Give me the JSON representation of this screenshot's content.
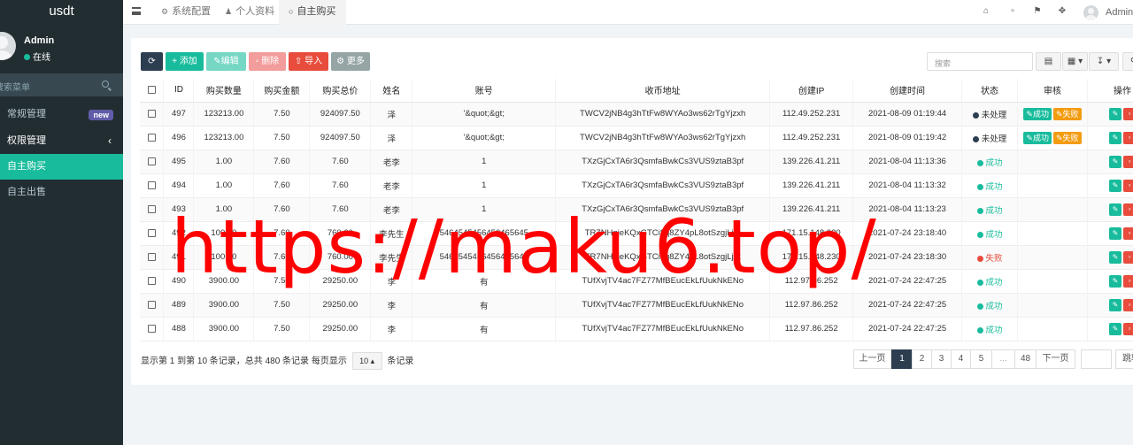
{
  "app": {
    "title": "usdt"
  },
  "sidebar": {
    "user": {
      "name": "Admin",
      "status": "在线"
    },
    "search_placeholder": "搜索菜单",
    "items": [
      {
        "label": "常规管理",
        "badge": "new"
      },
      {
        "label": "权限管理",
        "chevron": "‹"
      },
      {
        "label": "自主购买"
      },
      {
        "label": "自主出售"
      }
    ]
  },
  "topbar": {
    "tabs": [
      {
        "label": "系统配置",
        "icon": "⚙"
      },
      {
        "label": "个人资料",
        "icon": "👤"
      },
      {
        "label": "自主购买",
        "icon": "○"
      }
    ],
    "user": "Admin"
  },
  "toolbar": {
    "add": "添加",
    "edit": "编辑",
    "delete": "删除",
    "import": "导入",
    "more": "更多",
    "search_placeholder": "搜索"
  },
  "table": {
    "columns": [
      "ID",
      "购买数量",
      "购买金额",
      "购买总价",
      "姓名",
      "账号",
      "收币地址",
      "创建IP",
      "创建时间",
      "状态",
      "审核",
      "操作"
    ],
    "rows": [
      {
        "id": "497",
        "qty": "123213.00",
        "amount": "7.50",
        "total": "924097.50",
        "name": "泽",
        "account": "'&quot;&gt;",
        "address": "TWCV2jNB4g3hTtFw8WYAo3ws62rTgYjzxh",
        "ip": "112.49.252.231",
        "time": "2021-08-09 01:19:44",
        "status": "未处理",
        "status_type": "pend",
        "review": true
      },
      {
        "id": "496",
        "qty": "123213.00",
        "amount": "7.50",
        "total": "924097.50",
        "name": "泽",
        "account": "'&quot;&gt;",
        "address": "TWCV2jNB4g3hTtFw8WYAo3ws62rTgYjzxh",
        "ip": "112.49.252.231",
        "time": "2021-08-09 01:19:42",
        "status": "未处理",
        "status_type": "pend",
        "review": true
      },
      {
        "id": "495",
        "qty": "1.00",
        "amount": "7.60",
        "total": "7.60",
        "name": "老李",
        "account": "1",
        "address": "TXzGjCxTA6r3QsmfaBwkCs3VUS9ztaB3pf",
        "ip": "139.226.41.211",
        "time": "2021-08-04 11:13:36",
        "status": "成功",
        "status_type": "ok",
        "review": false
      },
      {
        "id": "494",
        "qty": "1.00",
        "amount": "7.60",
        "total": "7.60",
        "name": "老李",
        "account": "1",
        "address": "TXzGjCxTA6r3QsmfaBwkCs3VUS9ztaB3pf",
        "ip": "139.226.41.211",
        "time": "2021-08-04 11:13:32",
        "status": "成功",
        "status_type": "ok",
        "review": false
      },
      {
        "id": "493",
        "qty": "1.00",
        "amount": "7.60",
        "total": "7.60",
        "name": "老李",
        "account": "1",
        "address": "TXzGjCxTA6r3QsmfaBwkCs3VUS9ztaB3pf",
        "ip": "139.226.41.211",
        "time": "2021-08-04 11:13:23",
        "status": "成功",
        "status_type": "ok",
        "review": false
      },
      {
        "id": "492",
        "qty": "100.00",
        "amount": "7.60",
        "total": "760.00",
        "name": "李先生",
        "account": "5464545456456465645",
        "address": "TR7NHqjeKQxGTCi8q8ZY4pL8otSzgjLj6t",
        "ip": "171.15.148.230",
        "time": "2021-07-24 23:18:40",
        "status": "成功",
        "status_type": "ok",
        "review": false
      },
      {
        "id": "491",
        "qty": "100.00",
        "amount": "7.60",
        "total": "760.00",
        "name": "李先生",
        "account": "5464545456456465645",
        "address": "TR7NHqjeKQxGTCi8q8ZY4pL8otSzgjLj6t",
        "ip": "171.15.148.230",
        "time": "2021-07-24 23:18:30",
        "status": "失败",
        "status_type": "fail",
        "review": false
      },
      {
        "id": "490",
        "qty": "3900.00",
        "amount": "7.50",
        "total": "29250.00",
        "name": "李",
        "account": "有",
        "address": "TUfXvjTV4ac7FZ77MfBEucEkLfUukNkENo",
        "ip": "112.97.86.252",
        "time": "2021-07-24 22:47:25",
        "status": "成功",
        "status_type": "ok",
        "review": false
      },
      {
        "id": "489",
        "qty": "3900.00",
        "amount": "7.50",
        "total": "29250.00",
        "name": "李",
        "account": "有",
        "address": "TUfXvjTV4ac7FZ77MfBEucEkLfUukNkENo",
        "ip": "112.97.86.252",
        "time": "2021-07-24 22:47:25",
        "status": "成功",
        "status_type": "ok",
        "review": false
      },
      {
        "id": "488",
        "qty": "3900.00",
        "amount": "7.50",
        "total": "29250.00",
        "name": "李",
        "account": "有",
        "address": "TUfXvjTV4ac7FZ77MfBEucEkLfUukNkENo",
        "ip": "112.97.86.252",
        "time": "2021-07-24 22:47:25",
        "status": "成功",
        "status_type": "ok",
        "review": false
      }
    ],
    "review_ok": "成功",
    "review_fail": "失败"
  },
  "pagination": {
    "info": "显示第 1 到第 10 条记录，总共 480 条记录 每页显示",
    "page_size": "10",
    "suffix": "条记录",
    "prev": "上一页",
    "pages": [
      "1",
      "2",
      "3",
      "4",
      "5",
      "...",
      "48"
    ],
    "next": "下一页",
    "jump": "跳转"
  },
  "watermark": "https://maku6.top/",
  "colors": {
    "primary": "#18bc9c",
    "danger": "#e74c3c",
    "warning": "#f39c12",
    "dark": "#2c3e50",
    "sidebar": "#222d32"
  }
}
